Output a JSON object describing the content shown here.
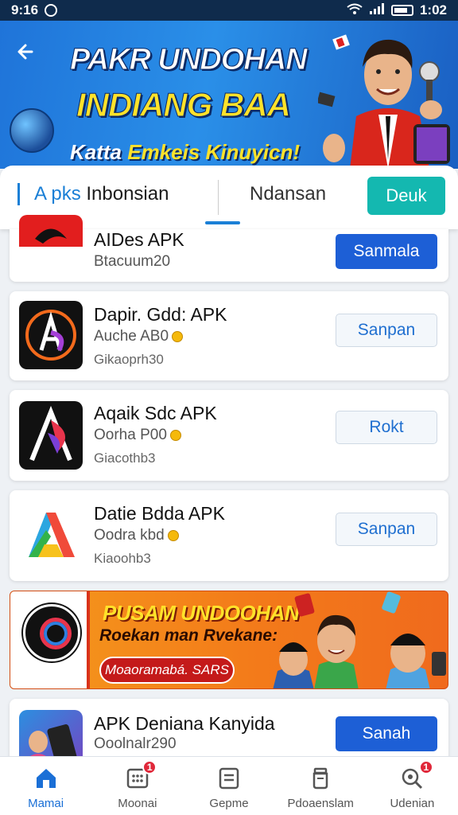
{
  "status_bar": {
    "time": "9:16",
    "clock_right": "1:02"
  },
  "hero": {
    "title_line1": "PAKR UNDOHAN",
    "title_line2": "INDIANG BAA",
    "subtitle_white": "Katta",
    "subtitle_yellow": "Emkeis Kinuyicn!"
  },
  "tabs": {
    "tab1_highlight": "A pks",
    "tab1_rest": " Inbonsian",
    "tab2": "Ndansan",
    "action_button": "Deuk"
  },
  "apps": [
    {
      "name": "AIDes APK",
      "line2": "Btacuum20",
      "line3": "",
      "button": "Sanmala",
      "button_style": "solid"
    },
    {
      "name": "Dapir. Gdd: APK",
      "line2": "Auche AB0",
      "line3": "Gikaoprh30",
      "button": "Sanpan",
      "button_style": "outline"
    },
    {
      "name": "Aqaik Sdc APK",
      "line2": "Oorha P00",
      "line3": "Giacothb3",
      "button": "Rokt",
      "button_style": "outline"
    },
    {
      "name": "Datie Bdda APK",
      "line2": "Oodra kbd",
      "line3": "Kiaoohb3",
      "button": "Sanpan",
      "button_style": "outline"
    }
  ],
  "promo": {
    "title": "PUSAM UNDOOHAN",
    "subtitle": "Roekan man Rvekane:",
    "cta": "Moaoramabá. SARS"
  },
  "last_app": {
    "name": "APK Deniana Kanyida",
    "line2": "Ooolnalr290",
    "button": "Sanah"
  },
  "bottom_nav": [
    {
      "label": "Mamai",
      "icon": "home-icon",
      "active": true,
      "badge": ""
    },
    {
      "label": "Moonai",
      "icon": "grid-icon",
      "active": false,
      "badge": "1"
    },
    {
      "label": "Gepme",
      "icon": "list-icon",
      "active": false,
      "badge": ""
    },
    {
      "label": "Pdoaenslam",
      "icon": "jar-icon",
      "active": false,
      "badge": ""
    },
    {
      "label": "Udenian",
      "icon": "search-icon",
      "active": false,
      "badge": "1"
    }
  ],
  "colors": {
    "accent": "#1a7fd6",
    "primary_button": "#1d5fd6",
    "teal_button": "#14b8b0",
    "badge": "#e0283a"
  }
}
